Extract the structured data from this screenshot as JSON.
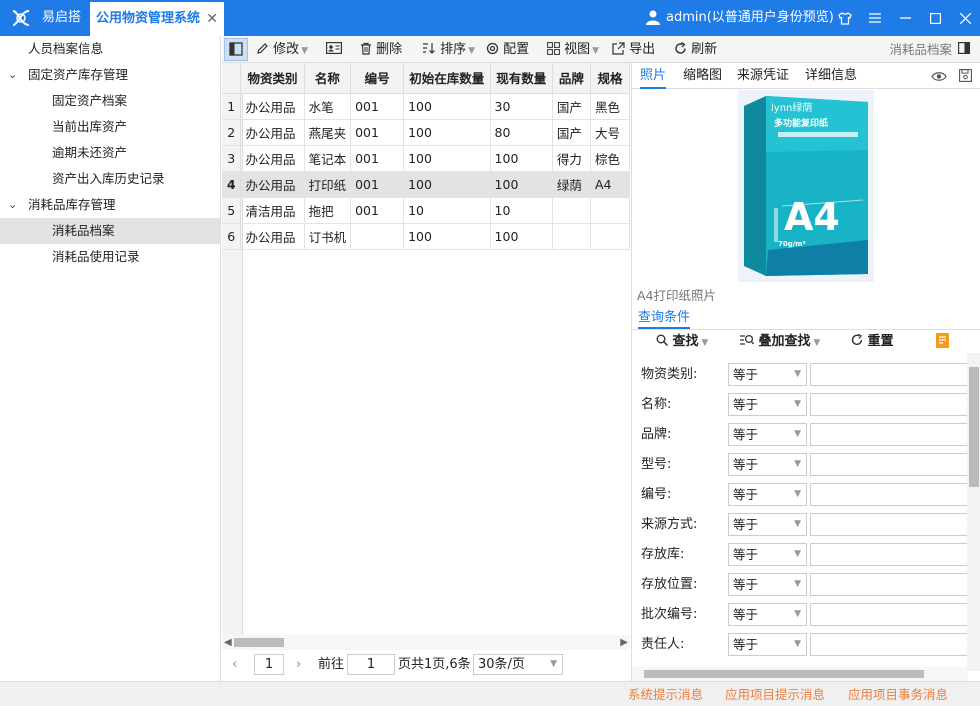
{
  "titlebar": {
    "app_name": "易启搭",
    "active_tab": "公用物资管理系统",
    "tab_close": "✕",
    "user": "admin(以普通用户身份预览)"
  },
  "tree": {
    "items": [
      {
        "label": "人员档案信息"
      },
      {
        "label": "固定资产库存管理",
        "toggle": "⌄"
      },
      {
        "label": "固定资产档案"
      },
      {
        "label": "当前出库资产"
      },
      {
        "label": "逾期未还资产"
      },
      {
        "label": "资产出入库历史记录"
      },
      {
        "label": "消耗品库存管理",
        "toggle": "⌄"
      },
      {
        "label": "消耗品档案"
      },
      {
        "label": "消耗品使用记录"
      }
    ]
  },
  "toolbar": {
    "modify": "修改",
    "delete": "删除",
    "sort": "排序",
    "config": "配置",
    "view": "视图",
    "export": "导出",
    "refresh": "刷新",
    "right_label": "消耗品档案"
  },
  "grid": {
    "columns": [
      "物资类别",
      "名称",
      "编号",
      "初始在库数量",
      "现有数量",
      "品牌",
      "规格"
    ],
    "rows": [
      {
        "n": "1",
        "c": [
          "办公用品",
          "水笔",
          "001",
          "100",
          "30",
          "国产",
          "黑色"
        ]
      },
      {
        "n": "2",
        "c": [
          "办公用品",
          "燕尾夹",
          "001",
          "100",
          "80",
          "国产",
          "大号"
        ]
      },
      {
        "n": "3",
        "c": [
          "办公用品",
          "笔记本",
          "001",
          "100",
          "100",
          "得力",
          "棕色"
        ]
      },
      {
        "n": "4",
        "c": [
          "办公用品",
          "打印纸",
          "001",
          "100",
          "100",
          "绿荫",
          "A4"
        ]
      },
      {
        "n": "5",
        "c": [
          "清洁用品",
          "拖把",
          "001",
          "10",
          "10",
          "",
          ""
        ]
      },
      {
        "n": "6",
        "c": [
          "办公用品",
          "订书机",
          "",
          "100",
          "100",
          "",
          ""
        ]
      }
    ],
    "selected_row": 4
  },
  "pager": {
    "page_value": "1",
    "goto_label": "前往",
    "goto_value": "1",
    "summary": "页共1页,6条",
    "page_size": "30条/页"
  },
  "right": {
    "tabs": [
      "照片",
      "缩略图",
      "来源凭证",
      "详细信息"
    ],
    "photo_caption": "A4打印纸照片",
    "product_brand": "lynn绿荫",
    "product_line": "多功能复印纸",
    "product_big": "A4",
    "product_weight": "70g/m²",
    "query_tab": "查询条件",
    "query_tools": {
      "find": "查找",
      "stack_find": "叠加查找",
      "reset": "重置"
    },
    "fields": [
      {
        "label": "物资类别:",
        "op": "等于"
      },
      {
        "label": "名称:",
        "op": "等于"
      },
      {
        "label": "品牌:",
        "op": "等于"
      },
      {
        "label": "型号:",
        "op": "等于"
      },
      {
        "label": "编号:",
        "op": "等于"
      },
      {
        "label": "来源方式:",
        "op": "等于"
      },
      {
        "label": "存放库:",
        "op": "等于"
      },
      {
        "label": "存放位置:",
        "op": "等于"
      },
      {
        "label": "批次编号:",
        "op": "等于"
      },
      {
        "label": "责任人:",
        "op": "等于"
      }
    ]
  },
  "status": {
    "sys_msg": "系统提示消息",
    "app_msg": "应用项目提示消息",
    "txn_msg": "应用项目事务消息"
  },
  "colors": {
    "accent": "#1f7be6",
    "status_text": "#f07d3a",
    "selection": "#e3e3e3"
  }
}
